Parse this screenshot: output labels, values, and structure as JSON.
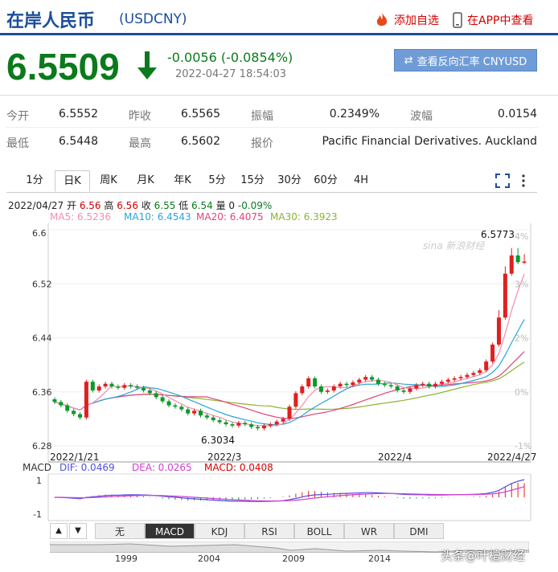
{
  "header": {
    "title": "在岸人民币",
    "code": "(USDCNY)",
    "watch_label": "添加自选",
    "app_label": "在APP中查看"
  },
  "quote": {
    "price": "6.5509",
    "change": "-0.0056 (-0.0854%)",
    "time": "2022-04-27 18:54:03",
    "reverse_label": "查看反向汇率 CNYUSD"
  },
  "stats": [
    [
      {
        "label": "今开",
        "value": "6.5552"
      },
      {
        "label": "昨收",
        "value": "6.5565"
      },
      {
        "label": "振幅",
        "value": "0.2349%"
      },
      {
        "label": "波幅",
        "value": "0.0154"
      }
    ],
    [
      {
        "label": "最低",
        "value": "6.5448"
      },
      {
        "label": "最高",
        "value": "6.5602"
      },
      {
        "label": "报价",
        "value": "Pacific Financial Derivatives. Auckland"
      }
    ]
  ],
  "tabs": [
    "1分",
    "日K",
    "周K",
    "月K",
    "年K",
    "5分",
    "15分",
    "30分",
    "60分",
    "4H"
  ],
  "active_tab": "日K",
  "ohlc_line": {
    "date": "2022/04/27",
    "open_label": "开",
    "open": "6.56",
    "high_label": "高",
    "high": "6.56",
    "close_label": "收",
    "close": "6.55",
    "low_label": "低",
    "low": "6.54",
    "vol_label": "量",
    "vol": "0",
    "pct": "-0.09%"
  },
  "ma": [
    {
      "text": "MA5: 6.5236",
      "color": "#f28db0"
    },
    {
      "text": "MA10: 6.4543",
      "color": "#2aa5d6"
    },
    {
      "text": "MA20: 6.4075",
      "color": "#e0447a"
    },
    {
      "text": "MA30: 6.3923",
      "color": "#8ab530"
    }
  ],
  "chart_data": {
    "type": "candlestick",
    "y_ticks": [
      "6.6",
      "6.52",
      "6.44",
      "6.36",
      "6.28"
    ],
    "pct_ticks": [
      "4%",
      "3%",
      "2%",
      "0%",
      "-1%"
    ],
    "x_ticks": [
      "2022/1/21",
      "2022/3",
      "2022/4",
      "2022/4/27"
    ],
    "ylim": [
      6.28,
      6.6
    ],
    "high_label": "6.5773",
    "low_label": "6.3034",
    "watermark": "sina 新浪财经",
    "closes": [
      6.345,
      6.34,
      6.332,
      6.327,
      6.322,
      6.375,
      6.362,
      6.368,
      6.372,
      6.368,
      6.366,
      6.37,
      6.368,
      6.366,
      6.362,
      6.358,
      6.352,
      6.346,
      6.34,
      6.338,
      6.334,
      6.328,
      6.332,
      6.325,
      6.322,
      6.318,
      6.315,
      6.312,
      6.31,
      6.314,
      6.312,
      6.308,
      6.306,
      6.31,
      6.312,
      6.316,
      6.32,
      6.338,
      6.358,
      6.368,
      6.38,
      6.368,
      6.36,
      6.362,
      6.368,
      6.372,
      6.37,
      6.374,
      6.378,
      6.382,
      6.378,
      6.372,
      6.37,
      6.368,
      6.362,
      6.36,
      6.365,
      6.37,
      6.372,
      6.368,
      6.372,
      6.375,
      6.378,
      6.38,
      6.382,
      6.385,
      6.388,
      6.392,
      6.405,
      6.43,
      6.47,
      6.535,
      6.562,
      6.552,
      6.553
    ]
  },
  "macd": {
    "label": "MACD",
    "dif": "DIF: 0.0469",
    "dea": "DEA: 0.0265",
    "macd": "MACD: 0.0408",
    "ticks": [
      "1",
      "-1"
    ]
  },
  "indicator_buttons": [
    "无",
    "MACD",
    "KDJ",
    "RSI",
    "BOLL",
    "WR",
    "DMI"
  ],
  "active_indicator": "MACD",
  "nav_years": [
    "1999",
    "2004",
    "2009",
    "2014"
  ],
  "watermark": "头条@叶檀财经"
}
